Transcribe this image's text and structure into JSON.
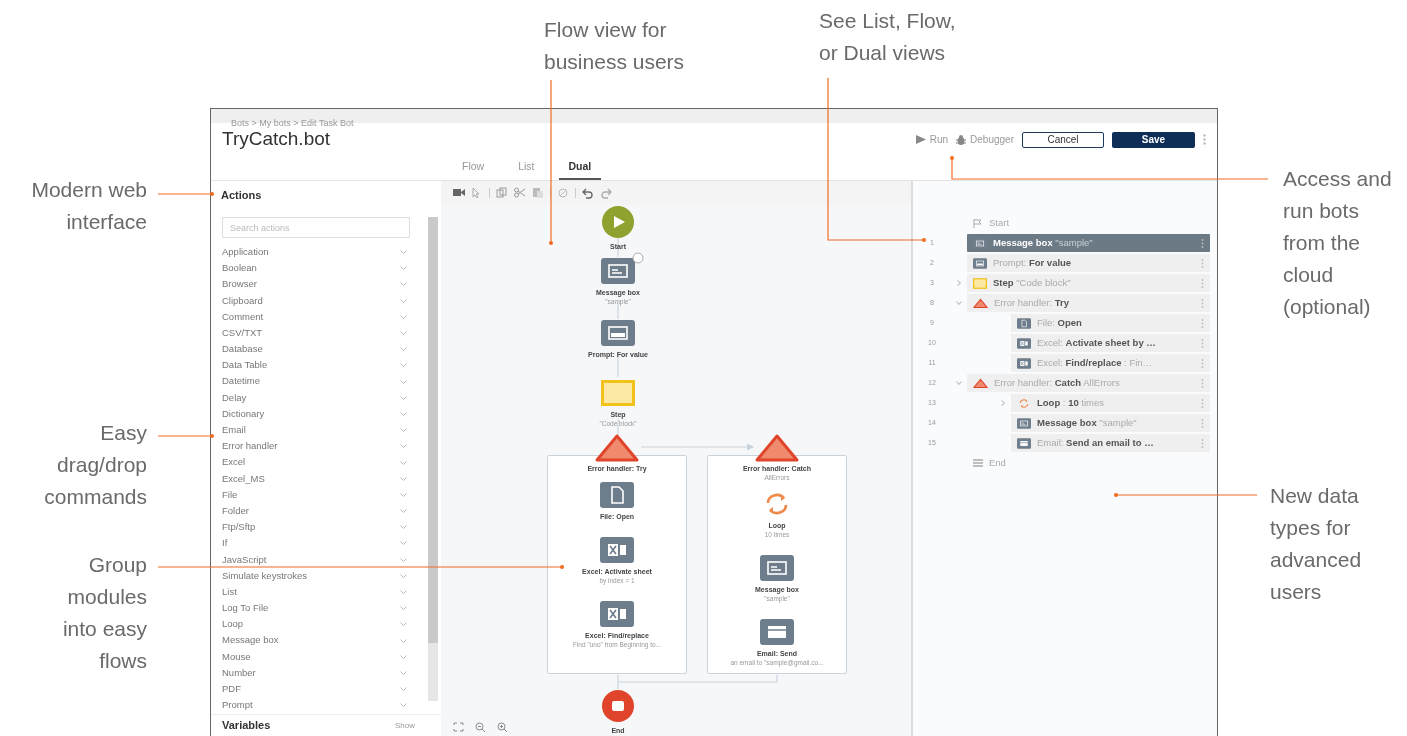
{
  "callouts": [
    {
      "text": "Flow view for\nbusiness users"
    },
    {
      "text": "See List, Flow,\nor Dual views"
    },
    {
      "text": "Modern web\ninterface"
    },
    {
      "text": "Access and\nrun bots\nfrom the\ncloud\n(optional)"
    },
    {
      "text": "Easy\ndrag/drop\ncommands"
    },
    {
      "text": "New data\ntypes for\nadvanced\nusers"
    },
    {
      "text": "Group\nmodules\ninto easy\nflows"
    }
  ],
  "window": {
    "breadcrumb": "Bots > My bots > Edit Task Bot",
    "title": "TryCatch.bot",
    "tabs": [
      {
        "label": "Flow",
        "selected": false
      },
      {
        "label": "List",
        "selected": false
      },
      {
        "label": "Dual",
        "selected": true
      }
    ],
    "actions": [
      {
        "kind": "run",
        "label": "Run"
      },
      {
        "kind": "debug",
        "label": "Debugger"
      },
      {
        "kind": "outline",
        "label": "Cancel"
      },
      {
        "kind": "primary",
        "label": "Save"
      }
    ]
  },
  "actions_panel": {
    "title": "Actions",
    "search": {
      "placeholder": "Search actions"
    },
    "items": [
      "Application",
      "Boolean",
      "Browser",
      "Clipboard",
      "Comment",
      "CSV/TXT",
      "Database",
      "Data Table",
      "Datetime",
      "Delay",
      "Dictionary",
      "Email",
      "Error handler",
      "Excel",
      "Excel_MS",
      "File",
      "Folder",
      "Ftp/Sftp",
      "If",
      "JavaScript",
      "Simulate keystrokes",
      "List",
      "Log To File",
      "Loop",
      "Message box",
      "Mouse",
      "Number",
      "PDF",
      "Prompt"
    ],
    "footer": {
      "title": "Variables",
      "toggle": "Show"
    }
  },
  "flow": {
    "nodes": [
      {
        "kind": "start",
        "label": "Start"
      },
      {
        "kind": "message",
        "label": "Message box",
        "caption": "\"sample\"",
        "badge": true
      },
      {
        "kind": "prompt",
        "label": "Prompt: For value"
      },
      {
        "kind": "step",
        "label": "Step",
        "caption": "\"Code block\""
      }
    ],
    "groups": [
      {
        "title": "Error handler: Try",
        "nodes": [
          {
            "kind": "file",
            "label": "File: Open"
          },
          {
            "kind": "excel",
            "label": "Excel: Activate sheet",
            "caption": "by index = 1"
          },
          {
            "kind": "excel",
            "label": "Excel: Find/replace",
            "caption": "Find \"uno\" from Beginning to..."
          }
        ]
      },
      {
        "title": "Error handler: Catch",
        "caption": "AllErrors",
        "nodes": [
          {
            "kind": "loop",
            "label": "Loop",
            "caption": "10 times"
          },
          {
            "kind": "message",
            "label": "Message box",
            "caption": "\"sample\""
          },
          {
            "kind": "email",
            "label": "Email: Send",
            "caption": "an email to \"sample@gmail.co..."
          }
        ]
      }
    ],
    "end": {
      "kind": "end",
      "label": "End"
    }
  },
  "list": {
    "rows": [
      {
        "kind": "start",
        "text": "Start",
        "selected": false
      },
      {
        "kind": "message",
        "number": "1",
        "text": "**Message box** \"sample\"",
        "selected": true
      },
      {
        "kind": "prompt",
        "number": "2",
        "text": "Prompt: **For value**",
        "selected": false
      },
      {
        "kind": "step",
        "number": "3",
        "text": "**Step** \"Code block\"",
        "selected": false,
        "expanded": false
      },
      {
        "kind": "error",
        "number": "8",
        "text": "Error handler: **Try**",
        "selected": false,
        "expanded": true,
        "children": [
          {
            "kind": "file",
            "number": "9",
            "text": "File: **Open**",
            "selected": false
          },
          {
            "kind": "excel",
            "number": "10",
            "text": "Excel: **Activate sheet by …**",
            "selected": false
          },
          {
            "kind": "excel",
            "number": "11",
            "text": "Excel: **Find/replace** : Fin…",
            "selected": false
          }
        ]
      },
      {
        "kind": "error",
        "number": "12",
        "text": "Error handler: **Catch** AllErrors",
        "selected": false,
        "expanded": true,
        "children": [
          {
            "kind": "loop",
            "number": "13",
            "text": "**Loop** : **10** times",
            "selected": false,
            "expanded": false
          },
          {
            "kind": "message",
            "number": "14",
            "text": "**Message box** \"sample\"",
            "selected": false
          },
          {
            "kind": "email",
            "number": "15",
            "text": "Email: **Send an email to …**",
            "selected": false
          }
        ]
      },
      {
        "kind": "end",
        "text": "End",
        "selected": false
      }
    ]
  }
}
